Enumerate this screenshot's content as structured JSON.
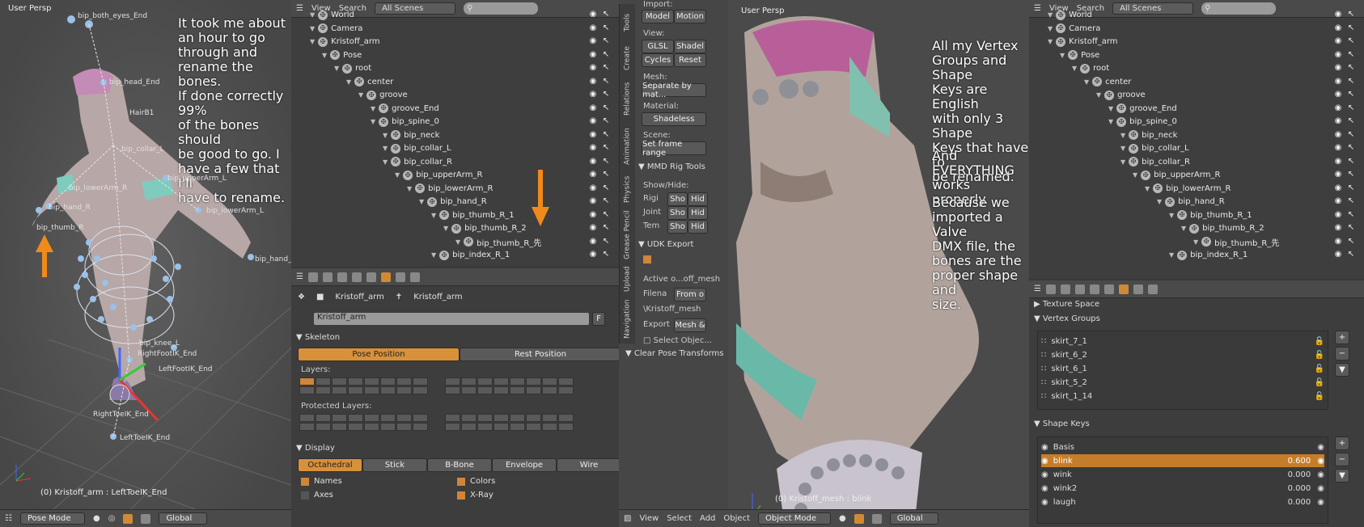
{
  "left_viewport": {
    "view_label": "User Persp",
    "status": "(0) Kristoff_arm : LeftToeIK_End",
    "annotation": [
      "It took me about",
      "an hour to go",
      "through and",
      "rename the bones.",
      "If done correctly 99%",
      "of the bones should",
      "be good to go. I",
      "have a few that I'll",
      "have to rename."
    ],
    "bone_labels": [
      "bip_both_eyes_End",
      "bip_head_End",
      "HairB1",
      "bip_collar_L",
      "bip_upperArm_L",
      "bip_lowerArm_L",
      "bip_hand_R",
      "bip_lowerArm_R",
      "bip_hand_L",
      "bip_knee_L",
      "RightFootIK_End",
      "LeftFootIK_End",
      "RightToeIK_End",
      "LeftToeIK_End",
      "bip_thumb_R"
    ],
    "bottom": {
      "mode": "Pose Mode",
      "pivot": "Global"
    }
  },
  "outliner1": {
    "menu": [
      "View",
      "Search"
    ],
    "scene_select": "All Scenes",
    "rows": [
      {
        "label": "World",
        "depth": 1
      },
      {
        "label": "Camera",
        "depth": 1
      },
      {
        "label": "Kristoff_arm",
        "depth": 1
      },
      {
        "label": "Pose",
        "depth": 2
      },
      {
        "label": "root",
        "depth": 3
      },
      {
        "label": "center",
        "depth": 4
      },
      {
        "label": "groove",
        "depth": 5
      },
      {
        "label": "groove_End",
        "depth": 6
      },
      {
        "label": "bip_spine_0",
        "depth": 6
      },
      {
        "label": "bip_neck",
        "depth": 7
      },
      {
        "label": "bip_collar_L",
        "depth": 7
      },
      {
        "label": "bip_collar_R",
        "depth": 7
      },
      {
        "label": "bip_upperArm_R",
        "depth": 8
      },
      {
        "label": "bip_lowerArm_R",
        "depth": 9
      },
      {
        "label": "bip_hand_R",
        "depth": 10
      },
      {
        "label": "bip_thumb_R_1",
        "depth": 11
      },
      {
        "label": "bip_thumb_R_2",
        "depth": 12
      },
      {
        "label": "bip_thumb_R_先",
        "depth": 13
      },
      {
        "label": "bip_index_R_1",
        "depth": 11
      }
    ]
  },
  "props1": {
    "breadcrumb": [
      "Kristoff_arm",
      "Kristoff_arm"
    ],
    "name_field": "Kristoff_arm",
    "name_flag": "F",
    "skeleton_header": "Skeleton",
    "pose_position": "Pose Position",
    "rest_position": "Rest Position",
    "layers_label": "Layers:",
    "protected_label": "Protected Layers:",
    "display_header": "Display",
    "display_types": [
      "Octahedral",
      "Stick",
      "B-Bone",
      "Envelope",
      "Wire"
    ],
    "checks": [
      {
        "label": "Names",
        "checked": true
      },
      {
        "label": "Colors",
        "checked": true
      },
      {
        "label": "Axes",
        "checked": false
      },
      {
        "label": "X-Ray",
        "checked": true
      }
    ]
  },
  "tools": {
    "tabs": [
      "Tools",
      "Create",
      "Relations",
      "Animation",
      "Physics",
      "Grease Pencil",
      "Upload",
      "Navigation"
    ],
    "import_label": "Import:",
    "model": "Model",
    "motion": "Motion",
    "view_label": "View:",
    "glsl": "GLSL",
    "shadel": "Shadel",
    "cycles": "Cycles",
    "reset": "Reset",
    "mesh_label": "Mesh:",
    "mesh_sel": "Separate by mat...",
    "material_label": "Material:",
    "material_sel": "Shadeless",
    "scene_label": "Scene:",
    "scene_btn": "Set frame range",
    "mmd_header": "MMD Rig Tools",
    "showhide": "Show/Hide:",
    "rows": [
      {
        "l": "Rigi",
        "a": "Sho",
        "b": "Hid"
      },
      {
        "l": "Joint",
        "a": "Sho",
        "b": "Hid"
      },
      {
        "l": "Tem",
        "a": "Sho",
        "b": "Hid"
      }
    ],
    "udk_header": "UDK Export",
    "active": "Active o...off_mesh",
    "filena": "Filena",
    "filena_val": "From o",
    "path": "\\Kristoff_mesh",
    "export": "Export",
    "export_val": "Mesh &",
    "select_obj": "Select Objec...",
    "clear_pose": "Clear Pose Transforms"
  },
  "right_viewport": {
    "view_label": "User Persp",
    "status": "(0) Kristoff_mesh : blink",
    "annotation1": [
      "All my Vertex",
      "Groups and Shape",
      "Keys are English",
      "with only 3 Shape",
      "Keys that have to",
      "be renamed."
    ],
    "annotation2": [
      "And EVERYTHING",
      "works properly."
    ],
    "annotation3": [
      "Because we",
      "imported a Valve",
      "DMX file, the",
      "bones are the",
      "proper shape and",
      "size."
    ],
    "menu": [
      "View",
      "Select",
      "Add",
      "Object"
    ],
    "mode": "Object Mode",
    "pivot": "Global"
  },
  "outliner2": {
    "menu": [
      "View",
      "Search"
    ],
    "scene_select": "All Scenes",
    "rows": [
      {
        "label": "World",
        "depth": 1
      },
      {
        "label": "Camera",
        "depth": 1
      },
      {
        "label": "Kristoff_arm",
        "depth": 1
      },
      {
        "label": "Pose",
        "depth": 2
      },
      {
        "label": "root",
        "depth": 3
      },
      {
        "label": "center",
        "depth": 4
      },
      {
        "label": "groove",
        "depth": 5
      },
      {
        "label": "groove_End",
        "depth": 6
      },
      {
        "label": "bip_spine_0",
        "depth": 6
      },
      {
        "label": "bip_neck",
        "depth": 7
      },
      {
        "label": "bip_collar_L",
        "depth": 7
      },
      {
        "label": "bip_collar_R",
        "depth": 7
      },
      {
        "label": "bip_upperArm_R",
        "depth": 8
      },
      {
        "label": "bip_lowerArm_R",
        "depth": 9
      },
      {
        "label": "bip_hand_R",
        "depth": 10
      },
      {
        "label": "bip_thumb_R_1",
        "depth": 11
      },
      {
        "label": "bip_thumb_R_2",
        "depth": 12
      },
      {
        "label": "bip_thumb_R_先",
        "depth": 13
      },
      {
        "label": "bip_index_R_1",
        "depth": 11
      }
    ]
  },
  "props2": {
    "texture_space": "Texture Space",
    "vg_header": "Vertex Groups",
    "vertex_groups": [
      "skirt_7_1",
      "skirt_6_2",
      "skirt_6_1",
      "skirt_5_2",
      "skirt_1_14"
    ],
    "sk_header": "Shape Keys",
    "shape_keys": [
      {
        "name": "Basis",
        "value": ""
      },
      {
        "name": "blink",
        "value": "0.600"
      },
      {
        "name": "wink",
        "value": "0.000"
      },
      {
        "name": "wink2",
        "value": "0.000"
      },
      {
        "name": "laugh",
        "value": "0.000"
      }
    ]
  }
}
